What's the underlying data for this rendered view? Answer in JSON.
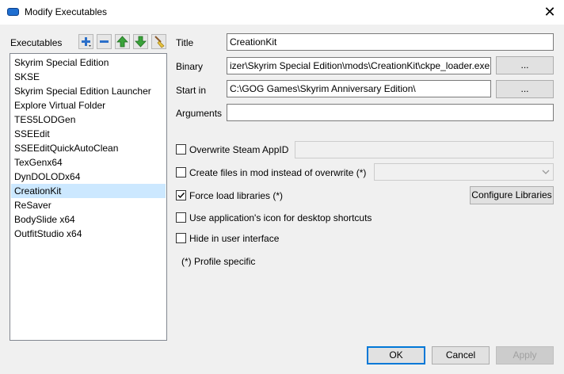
{
  "window": {
    "title": "Modify Executables",
    "close_glyph": "✕"
  },
  "executables": {
    "label": "Executables",
    "toolbar": [
      "add-icon",
      "remove-icon",
      "move-up-icon",
      "move-down-icon",
      "clear-icon"
    ],
    "items": [
      "Skyrim Special Edition",
      "SKSE",
      "Skyrim Special Edition Launcher",
      "Explore Virtual Folder",
      "TES5LODGen",
      "SSEEdit",
      "SSEEditQuickAutoClean",
      "TexGenx64",
      "DynDOLODx64",
      "CreationKit",
      "ReSaver",
      "BodySlide x64",
      "OutfitStudio x64"
    ],
    "selected": "CreationKit"
  },
  "form": {
    "title_label": "Title",
    "title_value": "CreationKit",
    "binary_label": "Binary",
    "binary_value": "izer\\Skyrim Special Edition\\mods\\CreationKit\\ckpe_loader.exe",
    "binary_browse": "...",
    "startin_label": "Start in",
    "startin_value": "C:\\GOG Games\\Skyrim Anniversary Edition\\",
    "startin_browse": "...",
    "arguments_label": "Arguments",
    "arguments_value": ""
  },
  "options": {
    "overwrite_appid": {
      "label": "Overwrite Steam AppID",
      "checked": false
    },
    "create_files": {
      "label": "Create files in mod instead of overwrite (*)",
      "checked": false
    },
    "force_load": {
      "label": "Force load libraries (*)",
      "checked": true
    },
    "configure_libraries": "Configure Libraries",
    "use_icon": {
      "label": "Use application's icon for desktop shortcuts",
      "checked": false
    },
    "hide_ui": {
      "label": "Hide in user interface",
      "checked": false
    },
    "profile_note": "(*) Profile specific"
  },
  "buttons": {
    "ok": "OK",
    "cancel": "Cancel",
    "apply": "Apply"
  }
}
